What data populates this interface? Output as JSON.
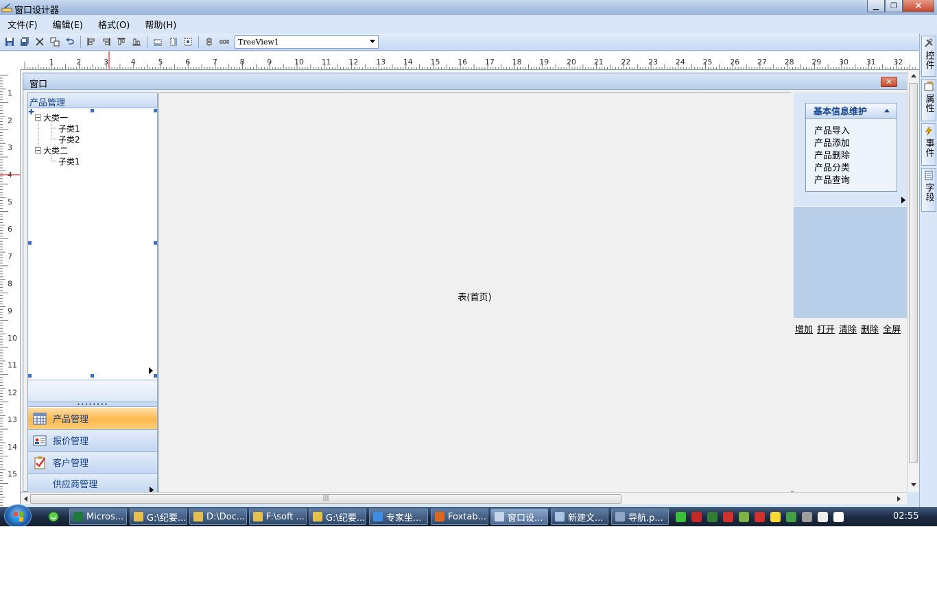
{
  "window": {
    "title": "窗口设计器",
    "min_label": "▁",
    "max_label": "❐",
    "close_label": "✕"
  },
  "menu": [
    "文件(F)",
    "编辑(E)",
    "格式(O)",
    "帮助(H)"
  ],
  "toolbar": {
    "combo_value": "TreeView1"
  },
  "ruler": {
    "h_numbers": [
      "1",
      "2",
      "3",
      "4",
      "5",
      "6",
      "7",
      "8",
      "9",
      "10",
      "11",
      "12",
      "13",
      "14",
      "15",
      "16",
      "17",
      "18",
      "19",
      "20",
      "21",
      "22",
      "23",
      "24",
      "25",
      "26",
      "27",
      "28",
      "29",
      "30",
      "31",
      "32"
    ],
    "v_numbers": [
      "1",
      "2",
      "3",
      "4",
      "5",
      "6",
      "7",
      "8",
      "9",
      "10",
      "11",
      "12",
      "13",
      "14",
      "15"
    ]
  },
  "side_tabs": [
    "控件",
    "属性",
    "事件",
    "字段"
  ],
  "form": {
    "title": "窗口",
    "close_label": "✕"
  },
  "left_panel": {
    "header": "产品管理",
    "tree": [
      {
        "label": "大类一",
        "level": 0,
        "expander": "−"
      },
      {
        "label": "子类1",
        "level": 1
      },
      {
        "label": "子类2",
        "level": 1
      },
      {
        "label": "大类二",
        "level": 0,
        "expander": "−"
      },
      {
        "label": "子类1",
        "level": 1
      }
    ],
    "grip": "••••••••",
    "nav": [
      {
        "label": "产品管理",
        "icon": "calendar-grid-icon",
        "active": true
      },
      {
        "label": "报价管理",
        "icon": "contact-card-icon",
        "active": false
      },
      {
        "label": "客户管理",
        "icon": "checklist-icon",
        "active": false
      },
      {
        "label": "供应商管理",
        "icon": "none",
        "active": false
      }
    ]
  },
  "center": {
    "label": "表(首页)"
  },
  "right_panel": {
    "group_title": "基本信息维护",
    "items": [
      "产品导入",
      "产品添加",
      "产品删除",
      "产品分类",
      "产品查询"
    ],
    "links": [
      "增加",
      "打开",
      "清除",
      "删除",
      "全屏"
    ]
  },
  "hscroll_grip": "|||",
  "taskbar": {
    "tasks": [
      {
        "label": "Micros...",
        "icon_color": "#1d7a3a"
      },
      {
        "label": "G:\\纪要...",
        "icon_color": "#e7c04c"
      },
      {
        "label": "D:\\Doc...",
        "icon_color": "#e7c04c"
      },
      {
        "label": "F:\\soft ...",
        "icon_color": "#e7c04c"
      },
      {
        "label": "G:\\纪要...",
        "icon_color": "#e7c04c"
      },
      {
        "label": "专家坐...",
        "icon_color": "#3b8ee0"
      },
      {
        "label": "Foxtab...",
        "icon_color": "#e0661f"
      },
      {
        "label": "窗口设...",
        "icon_color": "#c7d6ec"
      },
      {
        "label": "新建文...",
        "icon_color": "#a9c3e3"
      },
      {
        "label": "导航.p...",
        "icon_color": "#8fa6c4"
      }
    ],
    "clock": "02:55",
    "tray_colors": [
      "#3bbf3b",
      "#c62828",
      "#2e7d32",
      "#d32f2f",
      "#7cb342",
      "#d32f2f",
      "#fdd835",
      "#43a047",
      "#9e9e9e",
      "#eeeeee",
      "#ffffff"
    ]
  },
  "colors": {
    "accent": "#15428b",
    "active_nav": "#ffb94f",
    "panel_blue": "#d9e6f8"
  }
}
